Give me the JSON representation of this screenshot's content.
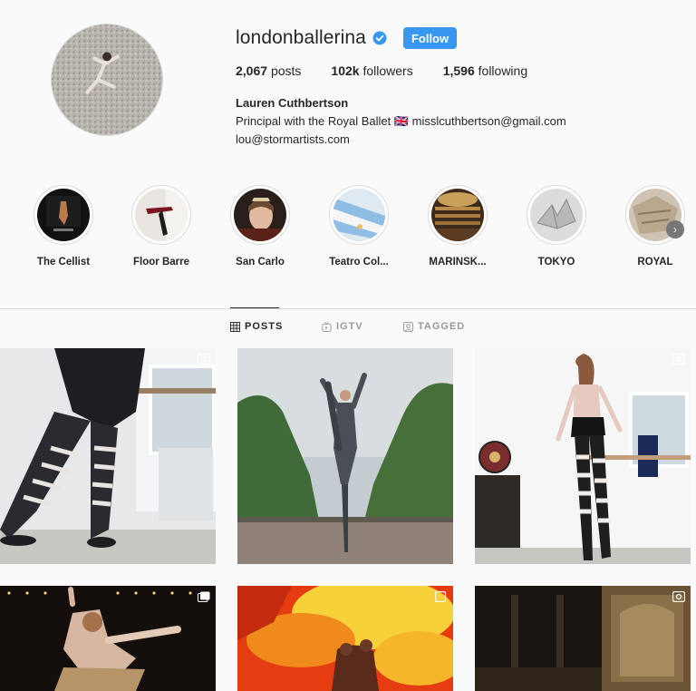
{
  "profile": {
    "username": "londonballerina",
    "follow_label": "Follow",
    "stats": [
      {
        "count": "2,067",
        "label": "posts"
      },
      {
        "count": "102k",
        "label": "followers"
      },
      {
        "count": "1,596",
        "label": "following"
      }
    ],
    "full_name": "Lauren Cuthbertson",
    "bio_line": "Principal with the Royal Ballet 🇬🇧",
    "email": "misslcuthbertson@gmail.com",
    "email2": "lou@stormartists.com"
  },
  "highlights": [
    {
      "label": "The Cellist"
    },
    {
      "label": "Floor Barre"
    },
    {
      "label": "San Carlo"
    },
    {
      "label": "Teatro Col..."
    },
    {
      "label": "MARINSK..."
    },
    {
      "label": "TOKYO"
    },
    {
      "label": "ROYAL"
    }
  ],
  "tabs": [
    {
      "label": "POSTS",
      "icon": "grid-icon",
      "active": true
    },
    {
      "label": "IGTV",
      "icon": "igtv-icon",
      "active": false
    },
    {
      "label": "TAGGED",
      "icon": "tagged-icon",
      "active": false
    }
  ],
  "colors": {
    "accent": "#3897f0",
    "verified": "#3897f0"
  }
}
